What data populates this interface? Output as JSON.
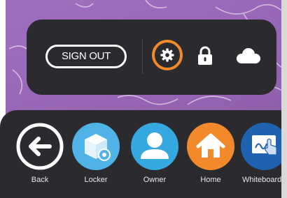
{
  "top_panel": {
    "signout_label": "SIGN OUT",
    "icons": [
      "gear-icon",
      "lock-icon",
      "cloud-icon"
    ],
    "highlight_color": "#f28a2c"
  },
  "dock": {
    "items": [
      {
        "label": "Back",
        "icon": "arrow-left-icon",
        "color": "#ffffff"
      },
      {
        "label": "Locker",
        "icon": "locker-box-icon",
        "color": "#4fb3e8"
      },
      {
        "label": "Owner",
        "icon": "person-icon",
        "color": "#35a8e0"
      },
      {
        "label": "Home",
        "icon": "house-icon",
        "color": "#f28a2c"
      },
      {
        "label": "Whiteboard",
        "icon": "whiteboard-hand-icon",
        "color": "#1f63b0"
      }
    ]
  },
  "colors": {
    "panel_bg": "#2b2a2e",
    "wallpaper": "#9a68b8"
  }
}
